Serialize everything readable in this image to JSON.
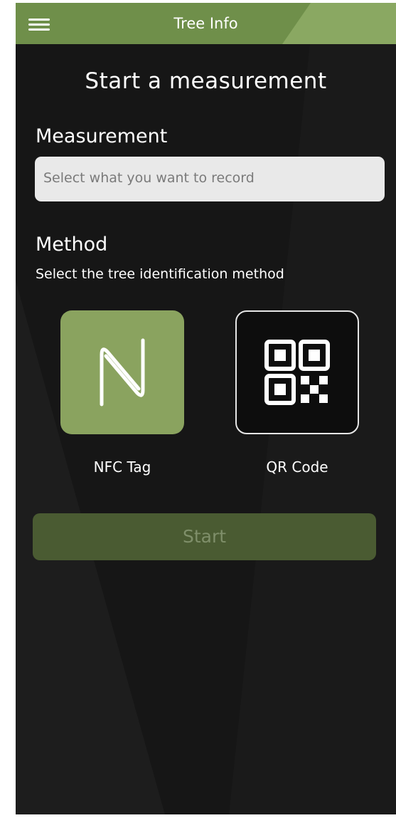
{
  "header": {
    "title": "Tree Info",
    "menu_icon": "hamburger-menu-icon",
    "color": "#6f8f4a"
  },
  "page": {
    "title": "Start a measurement"
  },
  "measurement": {
    "label": "Measurement",
    "placeholder": "Select what you want to record",
    "value": ""
  },
  "method": {
    "label": "Method",
    "description": "Select the tree identification method",
    "options": [
      {
        "label": "NFC Tag",
        "icon": "nfc-icon",
        "selected": true,
        "color": "#8aa35f"
      },
      {
        "label": "QR Code",
        "icon": "qr-code-icon",
        "selected": false
      }
    ]
  },
  "actions": {
    "start_label": "Start",
    "start_enabled": false,
    "button_color": "#4a5b32"
  }
}
